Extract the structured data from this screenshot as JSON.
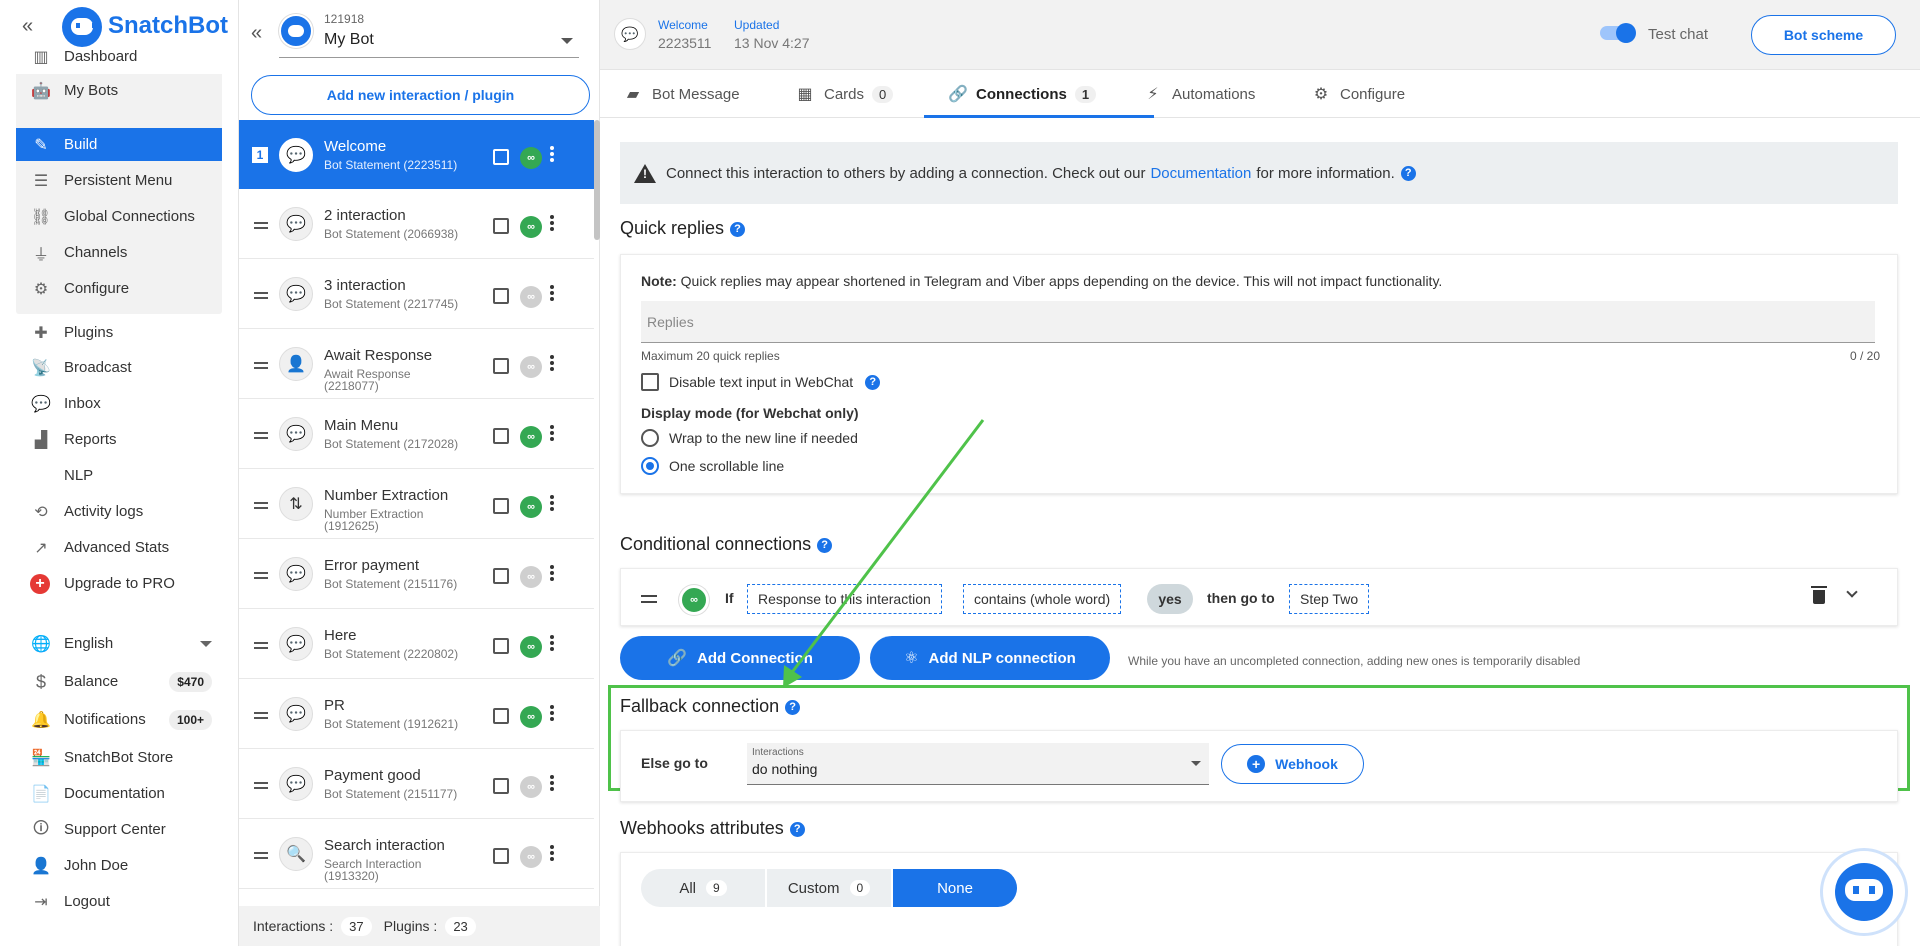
{
  "brand": {
    "name": "SnatchBot",
    "collapse_icon": "double-chevron-left-icon"
  },
  "nav": {
    "dashboard": "Dashboard",
    "my_bots": "My Bots",
    "build": "Build",
    "persistent_menu": "Persistent Menu",
    "global_connections": "Global Connections",
    "channels": "Channels",
    "configure": "Configure",
    "plugins": "Plugins",
    "broadcast": "Broadcast",
    "inbox": "Inbox",
    "reports": "Reports",
    "nlp": "NLP",
    "activity_logs": "Activity logs",
    "advanced_stats": "Advanced Stats",
    "upgrade": "Upgrade to PRO",
    "language": "English",
    "balance": "Balance",
    "balance_value": "$470",
    "notifications": "Notifications",
    "notifications_count": "100+",
    "store": "SnatchBot Store",
    "documentation": "Documentation",
    "support": "Support Center",
    "user": "John Doe",
    "logout": "Logout"
  },
  "bot": {
    "id": "121918",
    "name": "My Bot"
  },
  "add_interaction_label": "Add new interaction / plugin",
  "interactions": [
    {
      "name": "Welcome",
      "type": "Bot Statement (2223511)",
      "linked": true,
      "num": "1"
    },
    {
      "name": "2 interaction",
      "type": "Bot Statement (2066938)",
      "linked": true
    },
    {
      "name": "3 interaction",
      "type": "Bot Statement (2217745)",
      "linked": false
    },
    {
      "name": "Await Response",
      "type": "Await Response (2218077)",
      "linked": false
    },
    {
      "name": "Main Menu",
      "type": "Bot Statement (2172028)",
      "linked": true
    },
    {
      "name": "Number Extraction",
      "type": "Number Extraction (1912625)",
      "linked": true
    },
    {
      "name": "Error payment",
      "type": "Bot Statement (2151176)",
      "linked": false
    },
    {
      "name": "Here",
      "type": "Bot Statement (2220802)",
      "linked": true
    },
    {
      "name": "PR",
      "type": "Bot Statement (1912621)",
      "linked": true
    },
    {
      "name": "Payment good",
      "type": "Bot Statement (2151177)",
      "linked": false
    },
    {
      "name": "Search interaction",
      "type": "Search Interaction (1913320)",
      "linked": false
    }
  ],
  "footer": {
    "interactions_label": "Interactions :",
    "interactions_count": "37",
    "plugins_label": "Plugins :",
    "plugins_count": "23"
  },
  "header": {
    "welcome_label": "Welcome",
    "welcome_id": "2223511",
    "updated_label": "Updated",
    "updated_value": "13 Nov 4:27",
    "test_chat": "Test chat",
    "bot_scheme": "Bot scheme"
  },
  "tabs": [
    {
      "label": "Bot Message"
    },
    {
      "label": "Cards",
      "count": "0"
    },
    {
      "label": "Connections",
      "count": "1"
    },
    {
      "label": "Automations"
    },
    {
      "label": "Configure"
    }
  ],
  "alert": {
    "pre": "Connect this interaction to others by adding a connection. Check out our",
    "link": "Documentation",
    "post": "for more information."
  },
  "quick_replies": {
    "title": "Quick replies",
    "note_bold": "Note:",
    "note": "Quick replies may appear shortened in Telegram and Viber apps depending on the device. This will not impact functionality.",
    "placeholder": "Replies",
    "max": "Maximum 20 quick replies",
    "count": "0 / 20",
    "disable_label": "Disable text input in WebChat",
    "display_mode_title": "Display mode (for Webchat only)",
    "option_wrap": "Wrap to the new line if needed",
    "option_scroll": "One scrollable line"
  },
  "conditional": {
    "title": "Conditional connections",
    "if": "If",
    "field": "Response to this interaction",
    "operator": "contains (whole word)",
    "value": "yes",
    "then": "then go to",
    "target": "Step Two"
  },
  "buttons": {
    "add_connection": "Add Connection",
    "add_nlp": "Add NLP connection",
    "disabled_note": "While you have an uncompleted connection, adding new ones is temporarily disabled"
  },
  "fallback": {
    "title": "Fallback connection",
    "else": "Else go to",
    "caption": "Interactions",
    "value": "do nothing",
    "webhook": "Webhook"
  },
  "webhooks": {
    "title": "Webhooks attributes",
    "all": "All",
    "all_count": "9",
    "custom": "Custom",
    "custom_count": "0",
    "none": "None"
  },
  "colors": {
    "accent": "#1a73e8",
    "success": "#34a853",
    "highlight": "#4fc24a",
    "danger": "#e53935"
  }
}
